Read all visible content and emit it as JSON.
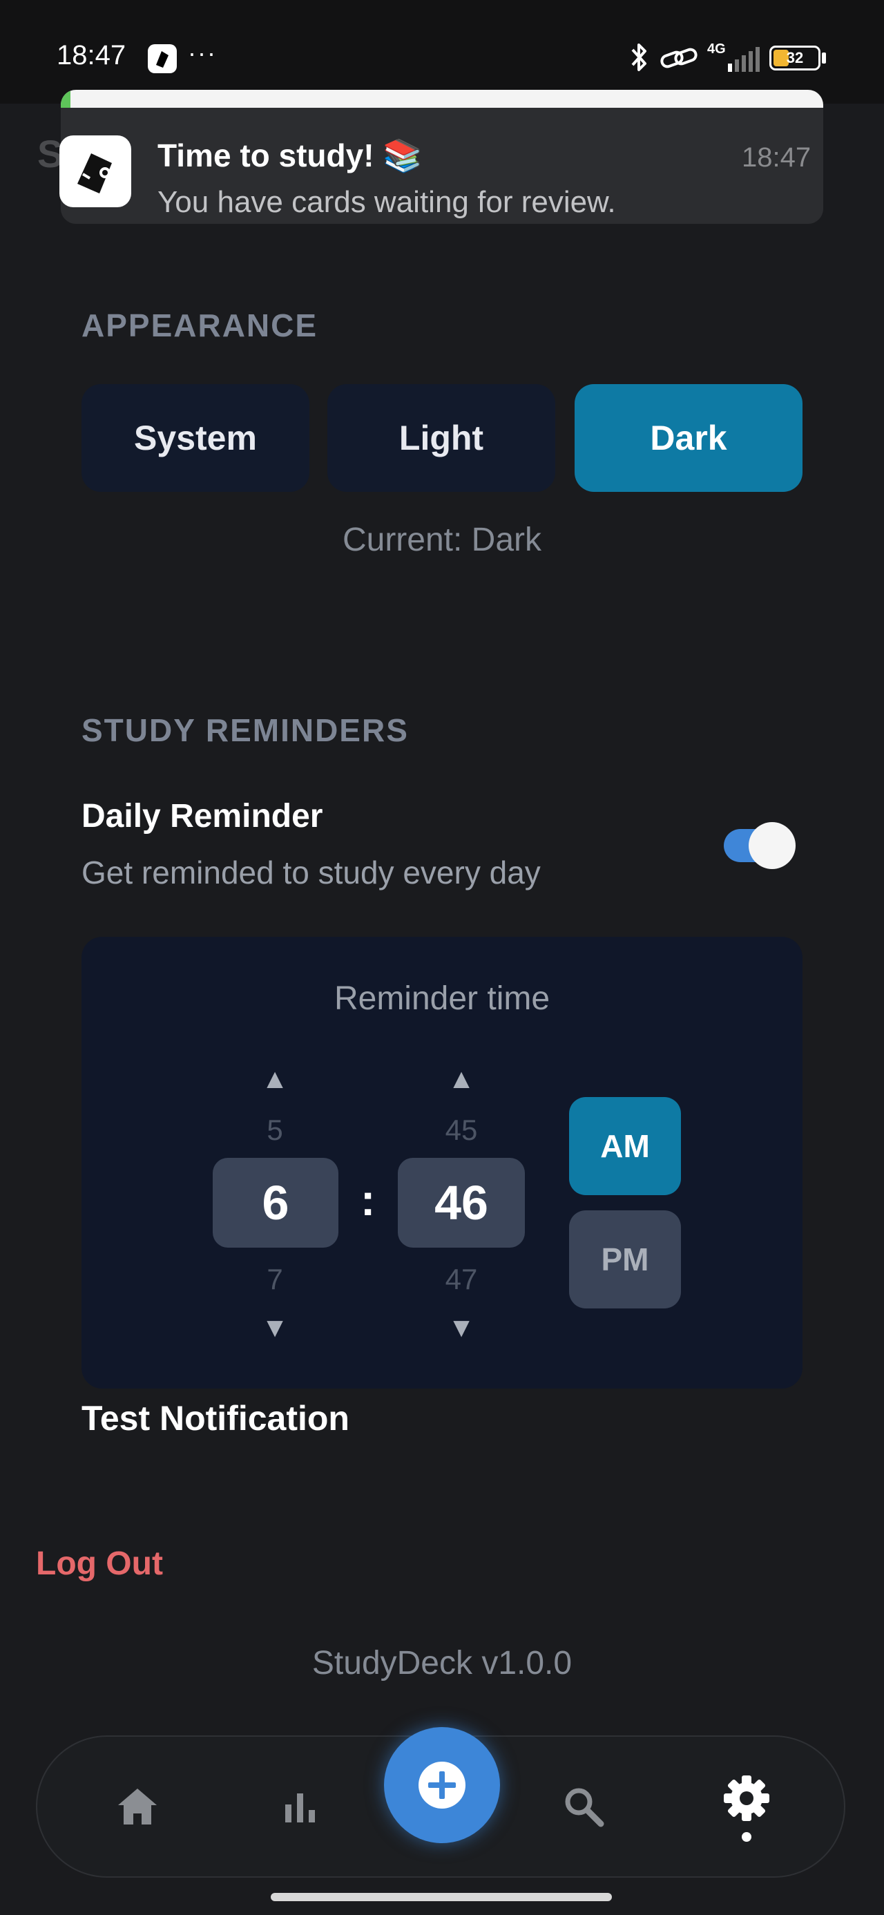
{
  "status_bar": {
    "time": "18:47",
    "more": "···",
    "network": "4G",
    "battery": "32"
  },
  "background_header": "S",
  "notification": {
    "title": "Time to study! 📚",
    "time": "18:47",
    "body": "You have cards waiting for review."
  },
  "appearance": {
    "label": "APPEARANCE",
    "options": [
      "System",
      "Light",
      "Dark"
    ],
    "selected": "Dark",
    "current_text": "Current: Dark"
  },
  "reminders": {
    "label": "STUDY REMINDERS",
    "daily_title": "Daily Reminder",
    "daily_subtitle": "Get reminded to study every day",
    "daily_enabled": true,
    "card_title": "Reminder time",
    "hour": {
      "prev": "5",
      "value": "6",
      "next": "7"
    },
    "separator": ":",
    "minute": {
      "prev": "45",
      "value": "46",
      "next": "47"
    },
    "am_label": "AM",
    "pm_label": "PM",
    "period": "AM",
    "up_arrow": "▲",
    "down_arrow": "▼"
  },
  "test_notification": "Test Notification",
  "logout": "Log Out",
  "version": "StudyDeck v1.0.0",
  "nav": {
    "items": [
      "home-icon",
      "stats-icon",
      "add-icon",
      "search-icon",
      "settings-icon"
    ],
    "active": "settings-icon"
  },
  "colors": {
    "accent": "#0e7aa4",
    "fab": "#3d86d8",
    "logout": "#e5686a"
  }
}
